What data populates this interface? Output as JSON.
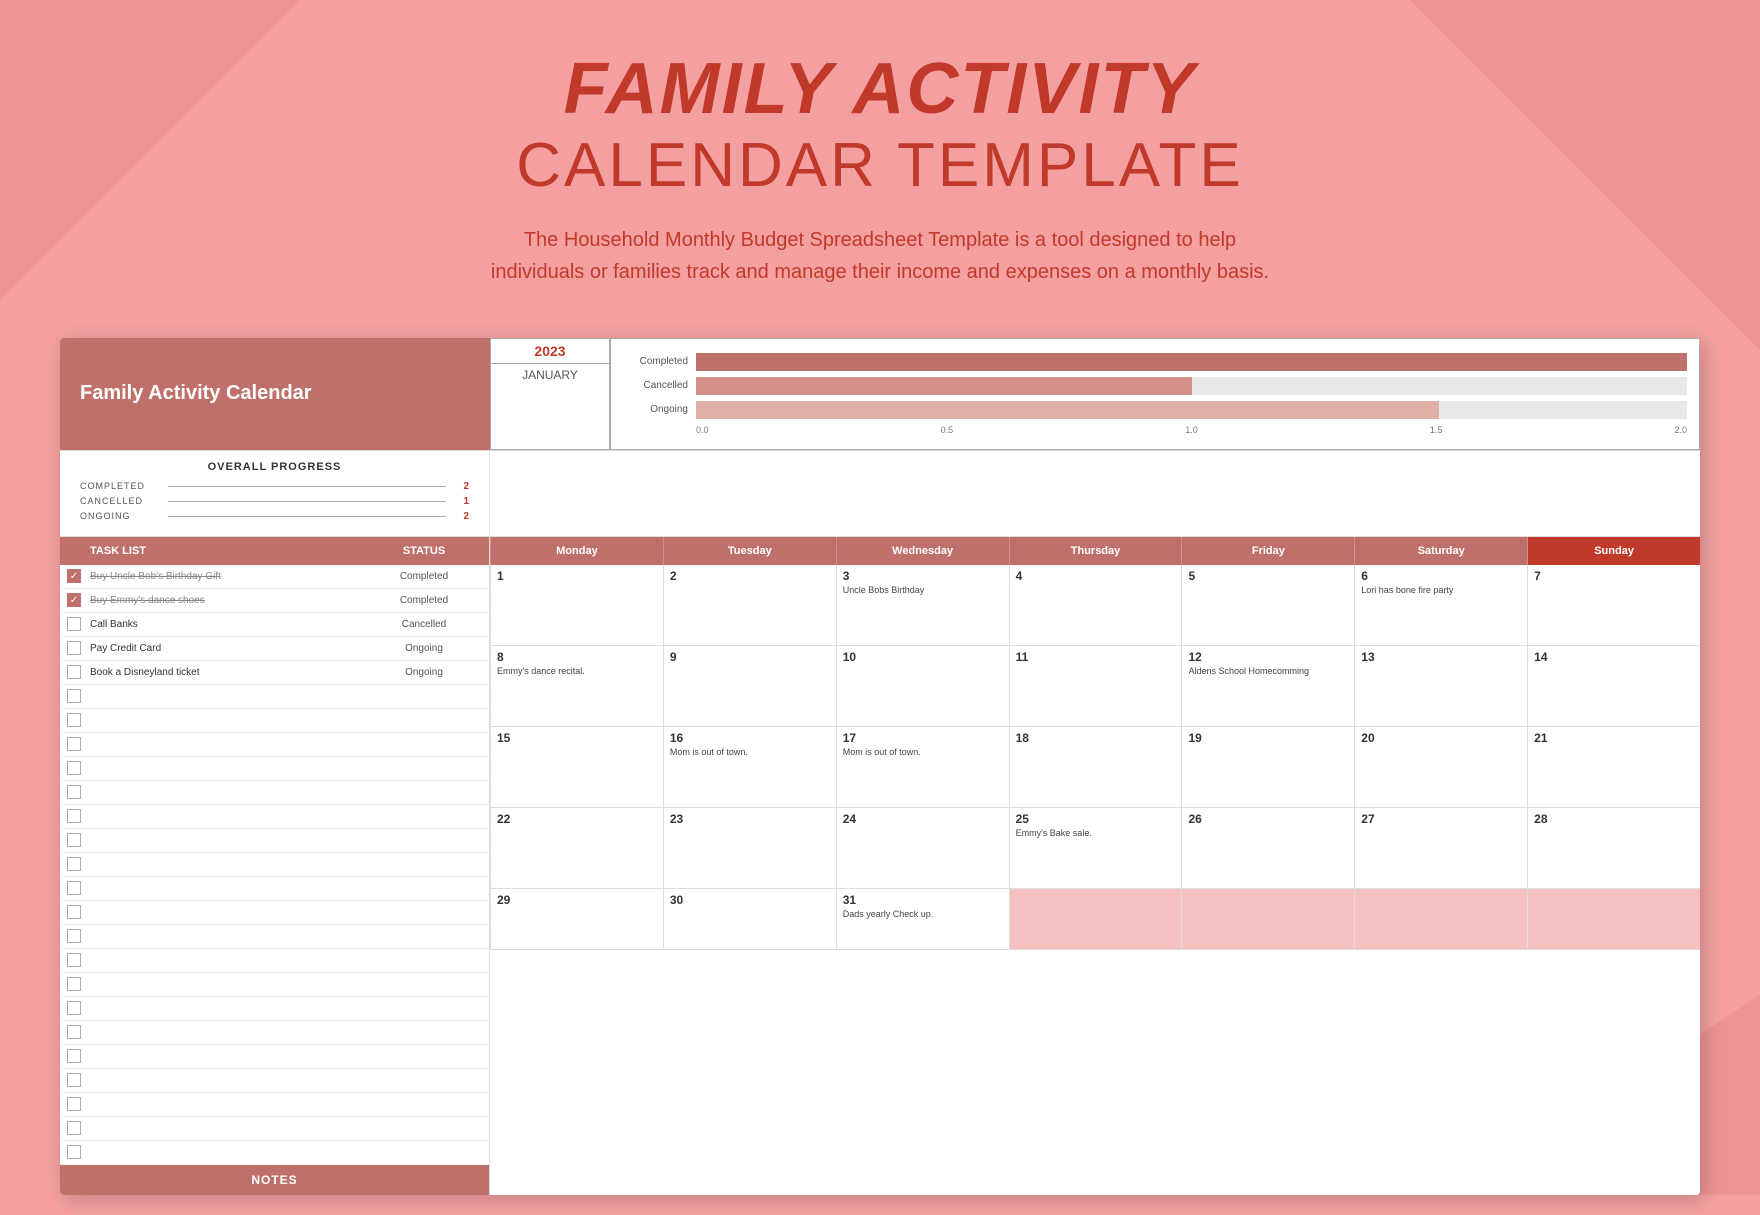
{
  "header": {
    "title_bold": "FAMILY ACTIVITY",
    "title_normal": "CALENDAR TEMPLATE",
    "subtitle": "The Household Monthly Budget Spreadsheet Template is a tool designed to help individuals or families track and manage their income and expenses on a monthly basis."
  },
  "card": {
    "title": "Family Activity Calendar",
    "year": "2023",
    "month": "JANUARY"
  },
  "progress": {
    "title": "OVERALL PROGRESS",
    "rows": [
      {
        "label": "COMPLETED",
        "value": "2"
      },
      {
        "label": "CANCELLED",
        "value": "1"
      },
      {
        "label": "ONGOING",
        "value": "2"
      }
    ]
  },
  "chart": {
    "categories": [
      "Completed",
      "Cancelled",
      "Ongoing"
    ],
    "values": [
      2.0,
      1.0,
      1.5
    ],
    "max": 2.0,
    "axis_labels": [
      "0.0",
      "0.5",
      "1.0",
      "1.5",
      "2.0"
    ]
  },
  "tasks": [
    {
      "name": "Buy Uncle Bob's Birthday Gift",
      "status": "Completed",
      "checked": true,
      "strike": true
    },
    {
      "name": "Buy Emmy's dance shoes",
      "status": "Completed",
      "checked": true,
      "strike": true
    },
    {
      "name": "Call Banks",
      "status": "Cancelled",
      "checked": false,
      "strike": false
    },
    {
      "name": "Pay Credit Card",
      "status": "Ongoing",
      "checked": false,
      "strike": false
    },
    {
      "name": "Book a Disneyland ticket",
      "status": "Ongoing",
      "checked": false,
      "strike": false
    },
    {
      "name": "",
      "status": "",
      "checked": false,
      "strike": false
    },
    {
      "name": "",
      "status": "",
      "checked": false,
      "strike": false
    },
    {
      "name": "",
      "status": "",
      "checked": false,
      "strike": false
    },
    {
      "name": "",
      "status": "",
      "checked": false,
      "strike": false
    },
    {
      "name": "",
      "status": "",
      "checked": false,
      "strike": false
    },
    {
      "name": "",
      "status": "",
      "checked": false,
      "strike": false
    },
    {
      "name": "",
      "status": "",
      "checked": false,
      "strike": false
    },
    {
      "name": "",
      "status": "",
      "checked": false,
      "strike": false
    },
    {
      "name": "",
      "status": "",
      "checked": false,
      "strike": false
    },
    {
      "name": "",
      "status": "",
      "checked": false,
      "strike": false
    },
    {
      "name": "",
      "status": "",
      "checked": false,
      "strike": false
    },
    {
      "name": "",
      "status": "",
      "checked": false,
      "strike": false
    },
    {
      "name": "",
      "status": "",
      "checked": false,
      "strike": false
    },
    {
      "name": "",
      "status": "",
      "checked": false,
      "strike": false
    },
    {
      "name": "",
      "status": "",
      "checked": false,
      "strike": false
    },
    {
      "name": "",
      "status": "",
      "checked": false,
      "strike": false
    },
    {
      "name": "",
      "status": "",
      "checked": false,
      "strike": false
    },
    {
      "name": "",
      "status": "",
      "checked": false,
      "strike": false
    },
    {
      "name": "",
      "status": "",
      "checked": false,
      "strike": false
    },
    {
      "name": "",
      "status": "",
      "checked": false,
      "strike": false
    }
  ],
  "notes_label": "NOTES",
  "calendar": {
    "days": [
      "Monday",
      "Tuesday",
      "Wednesday",
      "Thursday",
      "Friday",
      "Saturday",
      "Sunday"
    ],
    "weeks": [
      [
        {
          "num": "1",
          "event": ""
        },
        {
          "num": "2",
          "event": ""
        },
        {
          "num": "3",
          "event": "Uncle Bobs Birthday"
        },
        {
          "num": "4",
          "event": ""
        },
        {
          "num": "5",
          "event": ""
        },
        {
          "num": "6",
          "event": "Lori has bone fire party"
        },
        {
          "num": "7",
          "event": ""
        }
      ],
      [
        {
          "num": "8",
          "event": "Emmy's dance recital."
        },
        {
          "num": "9",
          "event": ""
        },
        {
          "num": "10",
          "event": ""
        },
        {
          "num": "11",
          "event": ""
        },
        {
          "num": "12",
          "event": "Aldens School Homecomming"
        },
        {
          "num": "13",
          "event": ""
        },
        {
          "num": "14",
          "event": ""
        }
      ],
      [
        {
          "num": "15",
          "event": ""
        },
        {
          "num": "16",
          "event": "Mom is out of town."
        },
        {
          "num": "17",
          "event": "Mom is out of town."
        },
        {
          "num": "18",
          "event": ""
        },
        {
          "num": "19",
          "event": ""
        },
        {
          "num": "20",
          "event": ""
        },
        {
          "num": "21",
          "event": ""
        }
      ],
      [
        {
          "num": "22",
          "event": ""
        },
        {
          "num": "23",
          "event": ""
        },
        {
          "num": "24",
          "event": ""
        },
        {
          "num": "25",
          "event": "Emmy's Bake sale."
        },
        {
          "num": "26",
          "event": ""
        },
        {
          "num": "27",
          "event": ""
        },
        {
          "num": "28",
          "event": ""
        }
      ],
      [
        {
          "num": "29",
          "event": ""
        },
        {
          "num": "30",
          "event": ""
        },
        {
          "num": "31",
          "event": "Dads yearly Check up."
        },
        {
          "num": "",
          "event": "",
          "shaded": true
        },
        {
          "num": "",
          "event": "",
          "shaded": true
        },
        {
          "num": "",
          "event": "",
          "shaded": true
        },
        {
          "num": "",
          "event": "",
          "shaded": true
        }
      ]
    ]
  }
}
